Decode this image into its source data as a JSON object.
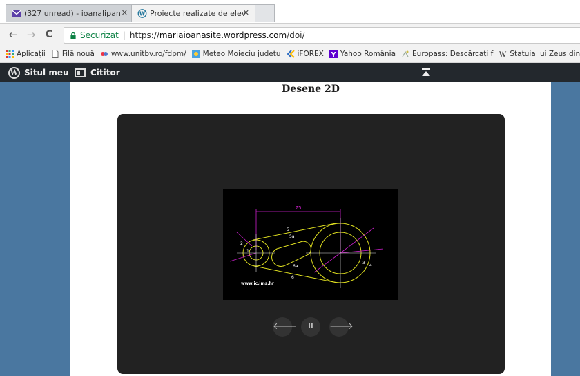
{
  "browser": {
    "tabs": [
      {
        "title": "(327 unread) - ioanalipan",
        "favicon": "mail-icon",
        "active": false
      },
      {
        "title": "Proiecte realizate de elev",
        "favicon": "wordpress-icon",
        "active": true
      }
    ],
    "close_glyph": "✕",
    "nav": {
      "back": "←",
      "forward": "→",
      "reload": "C"
    },
    "address": {
      "security_label": "Securizat",
      "separator": "|",
      "url_scheme": "https://",
      "url_host": "mariaioanasite.wordpress.com",
      "url_path": "/doi/"
    },
    "bookmarks": [
      {
        "label": "Aplicații",
        "icon": "apps-grid-icon"
      },
      {
        "label": "Filă nouă",
        "icon": "page-icon"
      },
      {
        "label": "www.unitbv.ro/fdpm/",
        "icon": "unitbv-icon"
      },
      {
        "label": "Meteo Moieciu judetu",
        "icon": "weather-icon"
      },
      {
        "label": "iFOREX",
        "icon": "iforex-icon"
      },
      {
        "label": "Yahoo România",
        "icon": "yahoo-icon"
      },
      {
        "label": "Europass: Descărcați f",
        "icon": "europass-icon"
      },
      {
        "label": "Statuia lui Zeus din O",
        "icon": "wikipedia-icon"
      }
    ]
  },
  "adminbar": {
    "my_site_label": "Situl meu",
    "reader_label": "Cititor"
  },
  "page": {
    "heading": "Desene 2D",
    "slideshow": {
      "controls": {
        "prev": "🡐",
        "pause": "II",
        "next": "🡒"
      },
      "drawing": {
        "dimension_top": "75",
        "labels": [
          "5",
          "5a",
          "6a",
          "6",
          "2",
          "1",
          "3",
          "4"
        ],
        "watermark": "www.ic.ims.hr"
      }
    }
  },
  "colors": {
    "page_bg": "#4a77a0",
    "admin_bar": "#23282d",
    "slideshow_bg": "#222222",
    "drawing_yellow": "#e0e020",
    "drawing_magenta": "#d020d0",
    "secure_green": "#0b8043"
  }
}
